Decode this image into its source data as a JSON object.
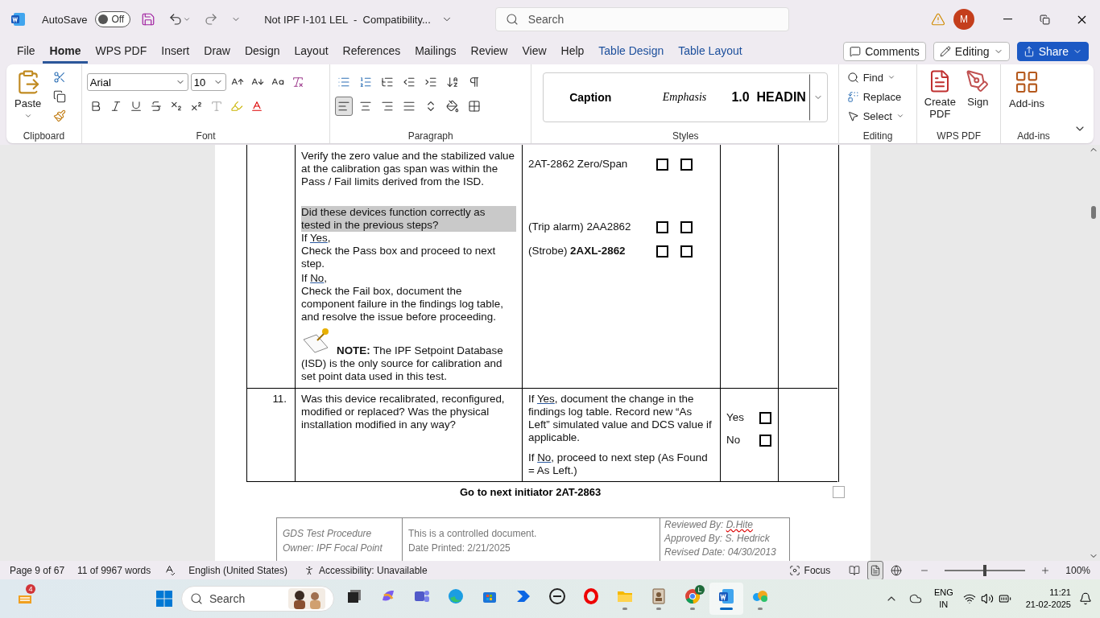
{
  "title_bar": {
    "autosave_label": "AutoSave",
    "autosave": {
      "on": false,
      "label": "Off"
    },
    "document_title": "Not IPF I-101 LEL  -  Compatibility...",
    "search_placeholder": "Search",
    "avatar": "M"
  },
  "tabs": [
    {
      "label": "File",
      "selected": false,
      "kind": "normal"
    },
    {
      "label": "Home",
      "selected": true,
      "kind": "normal"
    },
    {
      "label": "WPS PDF",
      "selected": false,
      "kind": "normal"
    },
    {
      "label": "Insert",
      "selected": false,
      "kind": "normal"
    },
    {
      "label": "Draw",
      "selected": false,
      "kind": "normal"
    },
    {
      "label": "Design",
      "selected": false,
      "kind": "normal"
    },
    {
      "label": "Layout",
      "selected": false,
      "kind": "normal"
    },
    {
      "label": "References",
      "selected": false,
      "kind": "normal"
    },
    {
      "label": "Mailings",
      "selected": false,
      "kind": "normal"
    },
    {
      "label": "Review",
      "selected": false,
      "kind": "normal"
    },
    {
      "label": "View",
      "selected": false,
      "kind": "normal"
    },
    {
      "label": "Help",
      "selected": false,
      "kind": "normal"
    },
    {
      "label": "Table Design",
      "selected": false,
      "kind": "contextual"
    },
    {
      "label": "Table Layout",
      "selected": false,
      "kind": "contextual"
    }
  ],
  "tab_actions": {
    "comments": "Comments",
    "editing": "Editing",
    "share": "Share"
  },
  "ribbon": {
    "clipboard": {
      "paste": "Paste",
      "label": "Clipboard"
    },
    "font": {
      "name": "Arial",
      "size": "10",
      "label": "Font"
    },
    "paragraph": {
      "label": "Paragraph",
      "align_left": true
    },
    "styles": {
      "items": [
        "Caption",
        "Emphasis",
        "1.0  HEADIN"
      ],
      "label": "Styles"
    },
    "editing": {
      "find": "Find",
      "replace": "Replace",
      "select": "Select",
      "label": "Editing"
    },
    "wps": {
      "create": "Create PDF",
      "sign": "Sign",
      "label": "WPS PDF"
    },
    "addins": {
      "button": "Add-ins",
      "label": "Add-ins"
    }
  },
  "document": {
    "step10": {
      "paragraphs": [
        {
          "kind": "plain",
          "text": "Verify the zero value and the stabilized value at the calibration gas span was within the Pass / Fail limits derived from the ISD."
        },
        {
          "kind": "highlight",
          "text": "Did these devices function correctly as tested in the previous steps?"
        },
        {
          "kind": "underlined",
          "before": "If ",
          "word": "Yes",
          "after": ","
        },
        {
          "kind": "plain",
          "text": "Check the Pass box and proceed to next step."
        },
        {
          "kind": "underlined",
          "before": "If ",
          "word": "No",
          "after": ","
        },
        {
          "kind": "plain",
          "text": "Check the Fail box, document the component failure in the findings log table, and resolve the issue before proceeding."
        },
        {
          "kind": "note",
          "text": "**NOTE:** The IPF Setpoint Database (ISD) is the only source for calibration and set point data used in this test."
        }
      ],
      "devices": [
        {
          "label": "2AT-2862 Zero/Span",
          "pass": false,
          "fail": false
        },
        {
          "label": "(Trip alarm) 2AA2862",
          "pass": false,
          "fail": false
        },
        {
          "label": "(Strobe) **2AXL-2862**",
          "pass": false,
          "fail": false
        }
      ]
    },
    "step11": {
      "number": "11.",
      "question": "Was this device recalibrated, reconfigured, modified or replaced? Was the physical installation modified in any way?",
      "instructions": [
        {
          "before": "If ",
          "word": "Yes",
          "after": ", document the change in the findings log table. Record new “As Left” simulated value and DCS value if applicable."
        },
        {
          "before": "If ",
          "word": "No",
          "after": ", proceed to next step (As Found = As Left.)"
        }
      ],
      "options": [
        {
          "label": "Yes",
          "checked": false
        },
        {
          "label": "No",
          "checked": false
        }
      ]
    },
    "next": "Go to next initiator 2AT-2863",
    "footer": {
      "left": [
        "GDS Test Procedure",
        "Owner: IPF Focal Point"
      ],
      "middle": [
        "This is a controlled document.",
        "Date Printed: 2/21/2025"
      ],
      "right": [
        {
          "text": "Reviewed By: ",
          "name": "D.Hite"
        },
        {
          "text": "Approved By: S. Hedrick"
        },
        {
          "text": "Revised Date: 04/30/2013"
        }
      ]
    }
  },
  "status_bar": {
    "page": "Page 9 of 67",
    "words": "11 of 9967 words",
    "language": "English (United States)",
    "accessibility": "Accessibility: Unavailable",
    "focus": "Focus",
    "zoom": {
      "level": 0.5,
      "reading": "100%"
    }
  },
  "taskbar": {
    "widgets_badge": "4",
    "search_placeholder": "Search",
    "apps": [
      {
        "kind": "taskview",
        "running": false,
        "active": false
      },
      {
        "kind": "copilot",
        "running": false,
        "active": false
      },
      {
        "kind": "teams",
        "running": false,
        "active": false
      },
      {
        "kind": "edge",
        "running": false,
        "active": false
      },
      {
        "kind": "store",
        "running": false,
        "active": false
      },
      {
        "kind": "automate",
        "running": false,
        "active": false
      },
      {
        "kind": "dell",
        "running": false,
        "active": false
      },
      {
        "kind": "opera",
        "running": false,
        "active": false
      },
      {
        "kind": "explorer",
        "running": true,
        "active": false
      },
      {
        "kind": "viewer",
        "running": true,
        "active": false
      },
      {
        "kind": "chrome",
        "running": true,
        "active": false,
        "badge": "L"
      },
      {
        "kind": "word",
        "running": true,
        "active": true
      },
      {
        "kind": "cloud",
        "running": true,
        "active": false
      }
    ],
    "language": [
      "ENG",
      "IN"
    ],
    "time": "11:21",
    "date": "21-02-2025"
  }
}
